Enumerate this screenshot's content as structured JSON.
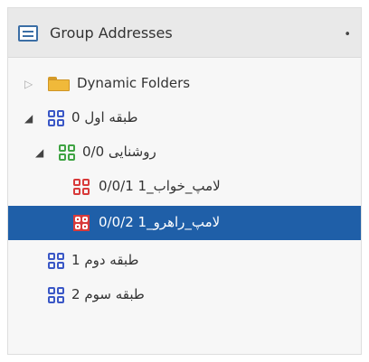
{
  "panel": {
    "title": "Group Addresses",
    "dropdown_symbol": "•"
  },
  "tree": {
    "dynamic_folders": "Dynamic Folders",
    "main_0": "طبقه اول 0",
    "middle_0_0": "روشنایی 0/0",
    "ga_0_0_1": "لامپ_خواب_1 0/0/1",
    "ga_0_0_2": "لامپ_راهرو_1 0/0/2",
    "main_1": "طبقه دوم 1",
    "main_2": "طبقه سوم 2"
  },
  "icons": {
    "header": "group-addresses-icon",
    "folder": "folder-icon",
    "group": "group-icon",
    "toggle_expanded": "◢",
    "toggle_collapsed": "▷"
  },
  "colors": {
    "selection": "#1f5fa8",
    "group_blue": "#3a57c6",
    "group_green": "#3fa343",
    "group_red": "#d83a3a",
    "folder": "#f0b93a"
  }
}
